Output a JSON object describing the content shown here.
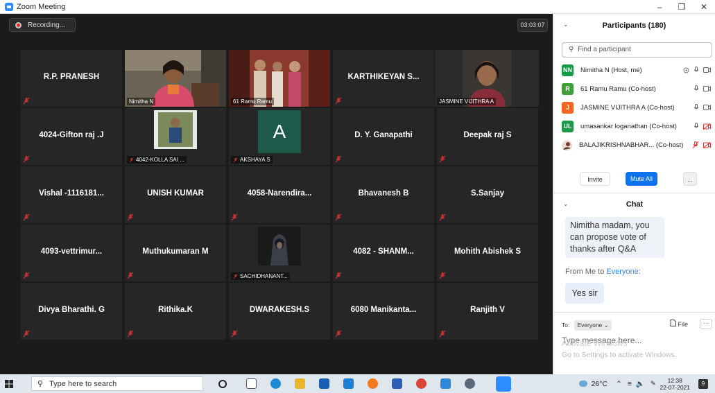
{
  "window": {
    "title": "Zoom Meeting",
    "controls": [
      "–",
      "❐",
      "✕"
    ]
  },
  "meeting": {
    "recording_label": "Recording...",
    "timer": "03:03:07"
  },
  "grid": {
    "row1": [
      {
        "name": "R.P. PRANESH"
      },
      {
        "label": "Nimitha N"
      },
      {
        "label": "61 Ramu Ramu"
      },
      {
        "name": "KARTHIKEYAN S..."
      },
      {
        "label": "JASMINE VIJITHRA A"
      }
    ],
    "row2": [
      {
        "name": "4024-Gifton raj .J"
      },
      {
        "label": "4042-KOLLA SAI ..."
      },
      {
        "label": "AKSHAYA S",
        "initial": "A"
      },
      {
        "name": "D. Y. Ganapathi"
      },
      {
        "name": "Deepak raj S"
      }
    ],
    "row3": [
      {
        "name": "Vishal -1116181..."
      },
      {
        "name": "UNISH KUMAR"
      },
      {
        "name": "4058-Narendira..."
      },
      {
        "name": "Bhavanesh B"
      },
      {
        "name": "S.Sanjay"
      }
    ],
    "row4": [
      {
        "name": "4093-vettrimur..."
      },
      {
        "name": "Muthukumaran M"
      },
      {
        "label": "SACHIDHANANT..."
      },
      {
        "name": "4082 - SHANM..."
      },
      {
        "name": "Mohith Abishek S"
      }
    ],
    "row5": [
      {
        "name": "Divya Bharathi. G"
      },
      {
        "name": "Rithika.K"
      },
      {
        "name": "DWARAKESH.S"
      },
      {
        "name": "6080  Manikanta..."
      },
      {
        "name": "Ranjith V"
      }
    ]
  },
  "participants": {
    "title": "Participants (180)",
    "search_placeholder": "Find a participant",
    "list": [
      {
        "initials": "NN",
        "color": "#1a9a47",
        "name": "Nimitha N (Host, me)"
      },
      {
        "initials": "R",
        "color": "#3f9f3a",
        "name": "61 Ramu Ramu (Co-host)"
      },
      {
        "initials": "J",
        "color": "#f26522",
        "name": "JASMINE VIJITHRA A (Co-host)"
      },
      {
        "initials": "UL",
        "color": "#1a9a47",
        "name": "umasankar loganathan (Co-host)"
      },
      {
        "initials": "",
        "color": "#7a3b2e",
        "name": "BALAJIKRISHNABHAR... (Co-host)"
      }
    ],
    "invite_label": "Invite",
    "mute_all_label": "Mute All",
    "more_label": "..."
  },
  "chat": {
    "title": "Chat",
    "message1": "Nimitha madam, you can propose vote of thanks after Q&A",
    "from_prefix": "From Me to ",
    "from_target": "Everyone",
    "from_suffix": ":",
    "message2": "Yes sir",
    "to_label": "To:",
    "to_value": "Everyone ⌄",
    "file_label": "File",
    "more_label": "···",
    "input_placeholder": "Type message here...",
    "watermark_title": "Activate Windows",
    "watermark_sub": "Go to Settings to activate Windows."
  },
  "taskbar": {
    "search_placeholder": "Type here to search",
    "weather": "26°C",
    "time": "12:38",
    "date": "22-07-2021",
    "notif_count": "9"
  }
}
